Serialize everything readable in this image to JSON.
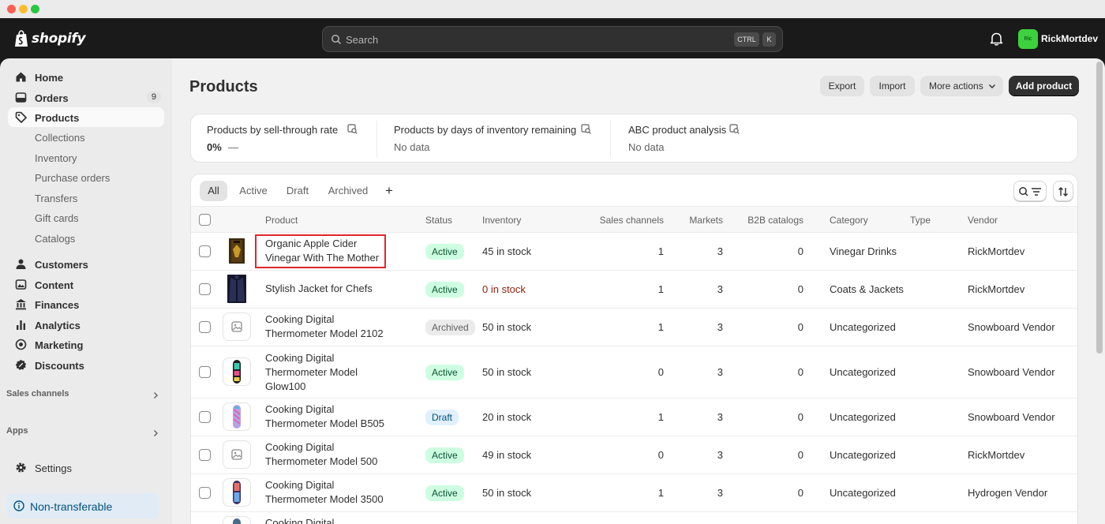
{
  "topbar": {
    "logo_text": "shopify",
    "search_placeholder": "Search",
    "shortcut_ctrl": "CTRL",
    "shortcut_key": "K",
    "avatar_initials": "Ric",
    "username": "RickMortdev"
  },
  "sidebar": {
    "items": [
      {
        "label": "Home",
        "icon": "home-icon"
      },
      {
        "label": "Orders",
        "icon": "orders-icon",
        "badge": "9"
      },
      {
        "label": "Products",
        "icon": "tag-icon",
        "active": true
      }
    ],
    "product_subitems": [
      "Collections",
      "Inventory",
      "Purchase orders",
      "Transfers",
      "Gift cards",
      "Catalogs"
    ],
    "items2": [
      {
        "label": "Customers",
        "icon": "person-icon"
      },
      {
        "label": "Content",
        "icon": "content-icon"
      },
      {
        "label": "Finances",
        "icon": "bank-icon"
      },
      {
        "label": "Analytics",
        "icon": "chart-icon"
      },
      {
        "label": "Marketing",
        "icon": "target-icon"
      },
      {
        "label": "Discounts",
        "icon": "discount-icon"
      }
    ],
    "sales_channels": "Sales channels",
    "apps": "Apps",
    "settings": "Settings",
    "notice": "Non-transferable"
  },
  "page": {
    "title": "Products",
    "export": "Export",
    "import": "Import",
    "more_actions": "More actions",
    "add_product": "Add product"
  },
  "analytics": [
    {
      "title": "Products by sell-through rate",
      "value": "0%",
      "extra": "—"
    },
    {
      "title": "Products by days of inventory remaining",
      "value": "No data"
    },
    {
      "title": "ABC product analysis",
      "value": "No data"
    }
  ],
  "tabs": [
    "All",
    "Active",
    "Draft",
    "Archived"
  ],
  "table": {
    "headers": {
      "product": "Product",
      "status": "Status",
      "inventory": "Inventory",
      "sales_channels": "Sales channels",
      "markets": "Markets",
      "b2b": "B2B catalogs",
      "category": "Category",
      "type": "Type",
      "vendor": "Vendor"
    },
    "rows": [
      {
        "name": "Organic Apple Cider Vinegar With The Mother",
        "status": "Active",
        "inventory": "45 in stock",
        "sales": "1",
        "markets": "3",
        "b2b": "0",
        "category": "Vinegar Drinks",
        "type": "",
        "vendor": "RickMortdev"
      },
      {
        "name": "Stylish Jacket for Chefs",
        "status": "Active",
        "inventory": "0 in stock",
        "sales": "1",
        "markets": "3",
        "b2b": "0",
        "category": "Coats & Jackets",
        "type": "",
        "vendor": "RickMortdev"
      },
      {
        "name": "Cooking Digital Thermometer Model 2102",
        "status": "Archived",
        "inventory": "50 in stock",
        "sales": "1",
        "markets": "3",
        "b2b": "0",
        "category": "Uncategorized",
        "type": "",
        "vendor": "Snowboard Vendor"
      },
      {
        "name": "Cooking Digital Thermometer Model Glow100",
        "status": "Active",
        "inventory": "50 in stock",
        "sales": "0",
        "markets": "3",
        "b2b": "0",
        "category": "Uncategorized",
        "type": "",
        "vendor": "Snowboard Vendor"
      },
      {
        "name": "Cooking Digital Thermometer Model B505",
        "status": "Draft",
        "inventory": "20 in stock",
        "sales": "1",
        "markets": "3",
        "b2b": "0",
        "category": "Uncategorized",
        "type": "",
        "vendor": "Snowboard Vendor"
      },
      {
        "name": "Cooking Digital Thermometer Model 500",
        "status": "Active",
        "inventory": "49 in stock",
        "sales": "0",
        "markets": "3",
        "b2b": "0",
        "category": "Uncategorized",
        "type": "",
        "vendor": "RickMortdev"
      },
      {
        "name": "Cooking Digital Thermometer Model 3500",
        "status": "Active",
        "inventory": "50 in stock",
        "sales": "1",
        "markets": "3",
        "b2b": "0",
        "category": "Uncategorized",
        "type": "",
        "vendor": "Hydrogen Vendor"
      },
      {
        "name": "Cooking Digital",
        "status": "",
        "inventory": "",
        "sales": "",
        "markets": "",
        "b2b": "",
        "category": "",
        "type": "",
        "vendor": ""
      }
    ]
  },
  "colors": {
    "accent_dark": "#303030",
    "active_badge": "#cdfee1",
    "highlight_box": "#e0262e",
    "avatar": "#3ed13e"
  }
}
